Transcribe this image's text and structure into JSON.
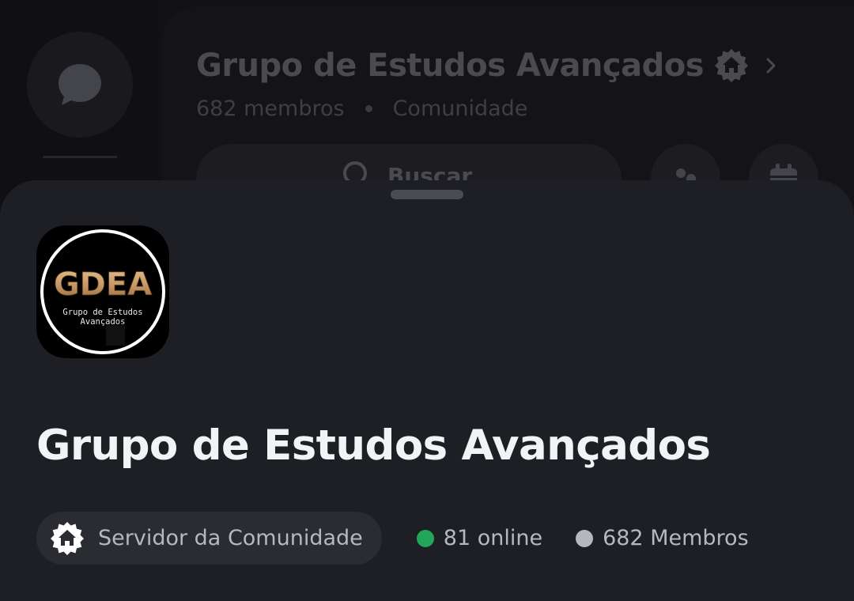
{
  "background": {
    "server_title": "Grupo de Estudos Avançados",
    "member_count": "682 membros",
    "server_type": "Comunidade",
    "search_label": "Buscar",
    "icons": {
      "dm": "chat-bubble-icon",
      "badge": "community-house-badge-icon",
      "chevron": "chevron-right-icon",
      "search": "search-icon",
      "threads": "threads-icon",
      "events": "calendar-icon"
    }
  },
  "sheet": {
    "server_icon": {
      "logo_text": "GDEA",
      "logo_subtext_line1": "Grupo de Estudos",
      "logo_subtext_line2": "Avançados"
    },
    "server_name": "Grupo de Estudos Avançados",
    "community_chip": {
      "label": "Servidor da Comunidade",
      "icon": "community-house-badge-icon"
    },
    "stats": {
      "online": "81 online",
      "members": "682 Membros"
    }
  },
  "colors": {
    "sheet_bg": "#1e1f24",
    "online_dot": "#23a55a",
    "members_dot": "#b5b8bf",
    "title_text": "#f2f3f5",
    "muted_text": "#b5b8bf",
    "logo_gold": "#c9a06a"
  }
}
